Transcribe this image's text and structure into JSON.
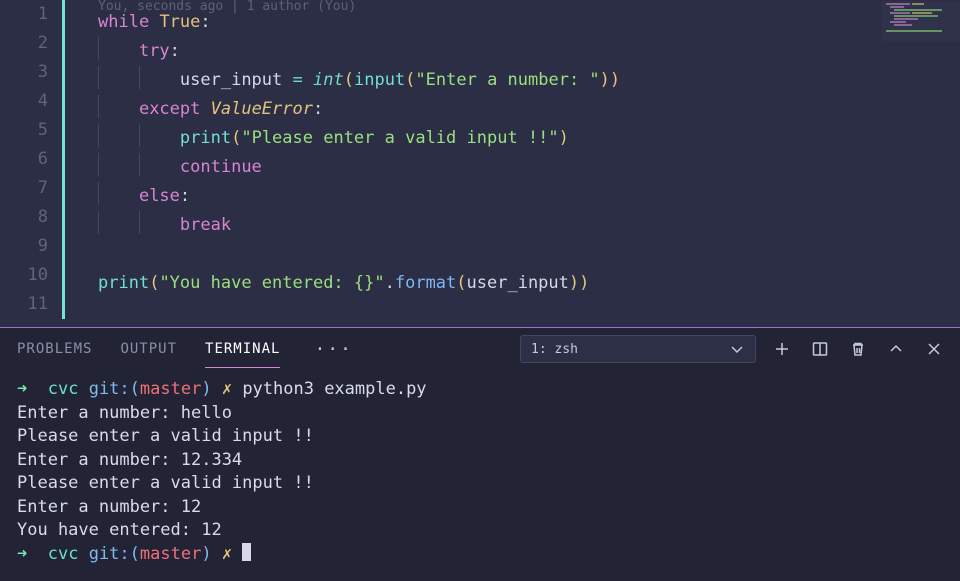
{
  "gitlens": "You, seconds ago | 1 author (You)",
  "code": {
    "l1": {
      "while": "while",
      "true": "True",
      "colon": ":"
    },
    "l2": {
      "try": "try",
      "colon": ":"
    },
    "l3": {
      "var": "user_input",
      "eq": "=",
      "int": "int",
      "input": "input",
      "str": "\"Enter a number: \""
    },
    "l4": {
      "except": "except",
      "exc": "ValueError",
      "colon": ":"
    },
    "l5": {
      "print": "print",
      "str": "\"Please enter a valid input !!\""
    },
    "l6": {
      "continue": "continue"
    },
    "l7": {
      "else": "else",
      "colon": ":"
    },
    "l8": {
      "break": "break"
    },
    "l10": {
      "print": "print",
      "str": "\"You have entered: {}\"",
      "format": "format",
      "var": "user_input"
    }
  },
  "line_numbers": [
    "1",
    "2",
    "3",
    "4",
    "5",
    "6",
    "7",
    "8",
    "9",
    "10",
    "11"
  ],
  "panel": {
    "tabs": {
      "problems": "PROBLEMS",
      "output": "OUTPUT",
      "terminal": "TERMINAL",
      "more": "···"
    },
    "dropdown": "1: zsh"
  },
  "terminal": {
    "prompt": {
      "arrow": "➜",
      "dir": "cvc",
      "git": "git:(",
      "branch": "master",
      "close": ")",
      "x": "✗"
    },
    "cmd1": "python3 example.py",
    "lines": [
      "Enter a number: hello",
      "Please enter a valid input !!",
      "Enter a number: 12.334",
      "Please enter a valid input !!",
      "Enter a number: 12",
      "You have entered: 12"
    ]
  }
}
